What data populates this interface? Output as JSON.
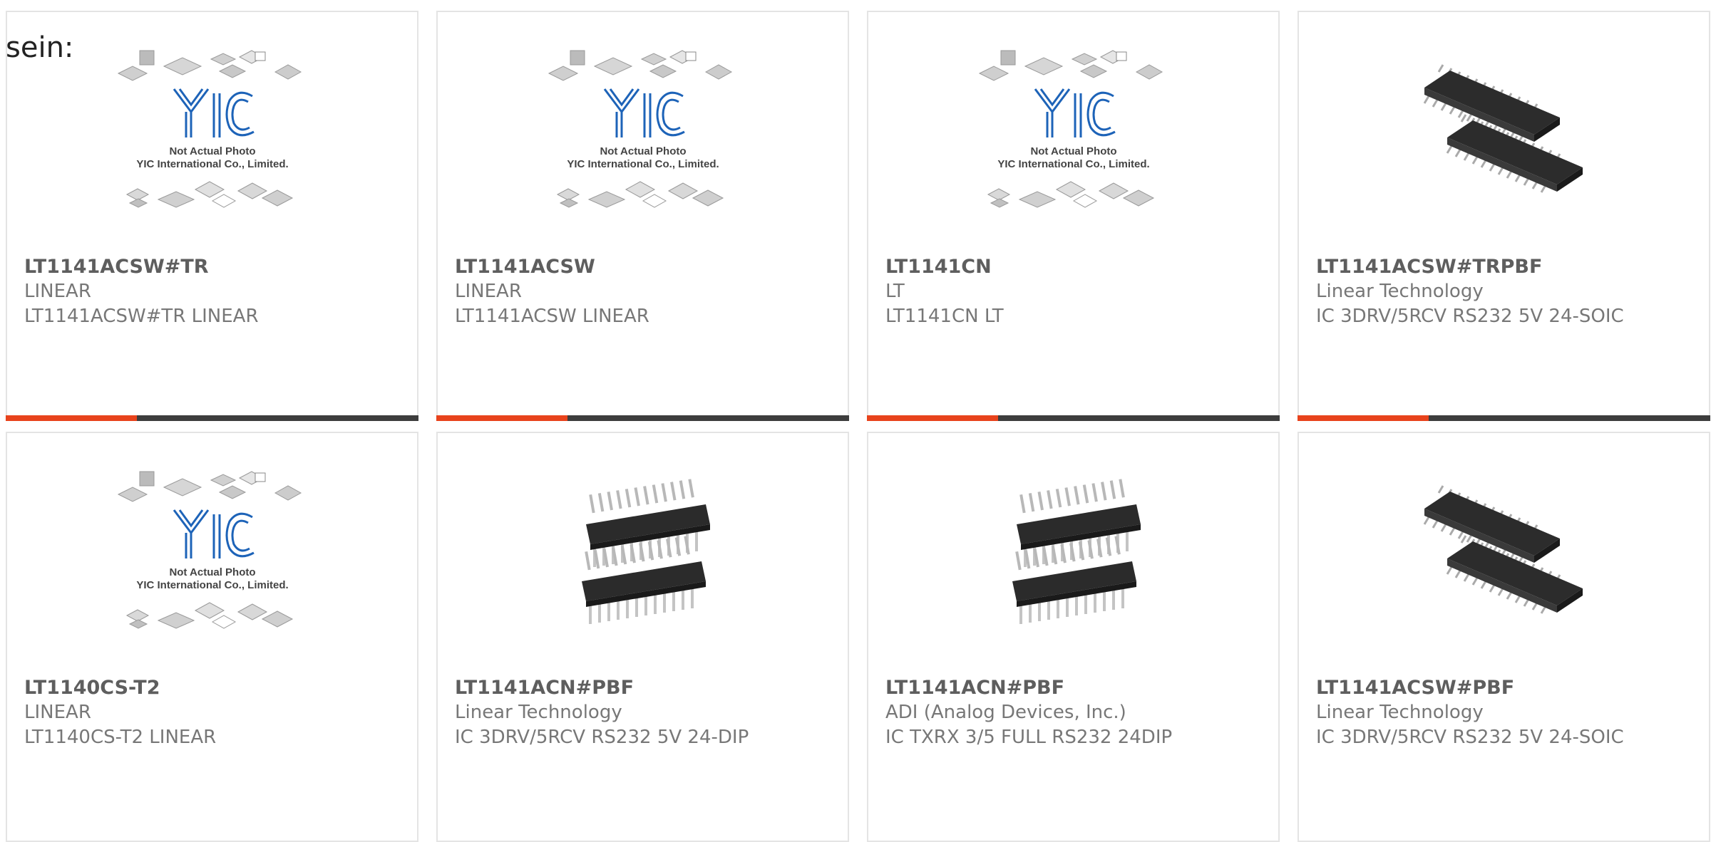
{
  "intro_text": "sein:",
  "colors": {
    "accent": "#e8431c",
    "bar": "#3d3d3d",
    "border": "#e4e4e4",
    "yic_blue": "#1d63b8"
  },
  "products": [
    {
      "part": "LT1141ACSW#TR",
      "manufacturer": "LINEAR",
      "description": "LT1141ACSW#TR LINEAR",
      "image": "placeholder",
      "show_bar": true
    },
    {
      "part": "LT1141ACSW",
      "manufacturer": "LINEAR",
      "description": "LT1141ACSW LINEAR",
      "image": "placeholder",
      "show_bar": true
    },
    {
      "part": "LT1141CN",
      "manufacturer": "LT",
      "description": "LT1141CN LT",
      "image": "placeholder",
      "show_bar": true
    },
    {
      "part": "LT1141ACSW#TRPBF",
      "manufacturer": "Linear Technology",
      "description": "IC 3DRV/5RCV RS232 5V 24-SOIC",
      "image": "soic",
      "show_bar": true
    },
    {
      "part": "LT1140CS-T2",
      "manufacturer": "LINEAR",
      "description": "LT1140CS-T2 LINEAR",
      "image": "placeholder",
      "show_bar": false
    },
    {
      "part": "LT1141ACN#PBF",
      "manufacturer": "Linear Technology",
      "description": "IC 3DRV/5RCV RS232 5V 24-DIP",
      "image": "dip",
      "show_bar": false
    },
    {
      "part": "LT1141ACN#PBF",
      "manufacturer": "ADI (Analog Devices, Inc.)",
      "description": "IC TXRX 3/5 FULL RS232 24DIP",
      "image": "dip",
      "show_bar": false
    },
    {
      "part": "LT1141ACSW#PBF",
      "manufacturer": "Linear Technology",
      "description": "IC 3DRV/5RCV RS232 5V 24-SOIC",
      "image": "soic",
      "show_bar": false
    }
  ],
  "placeholder": {
    "line1": "Not Actual Photo",
    "line2": "YIC International Co., Limited.",
    "logo_text": "YIC"
  }
}
